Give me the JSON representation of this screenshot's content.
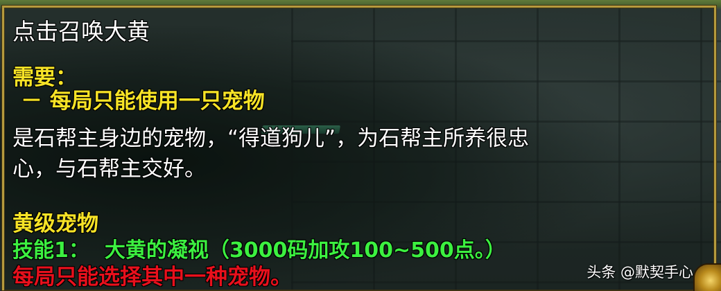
{
  "tooltip": {
    "title": "点击召唤大黄",
    "requirement_header": "需要：",
    "requirement_item": "－ 每局只能使用一只宠物",
    "description_line1": "是石帮主身边的宠物，“得道狗儿”，为石帮主所养很忠",
    "description_line2": "心，与石帮主交好。",
    "grade": "黄级宠物",
    "skill_label": "技能1：",
    "skill_text": "大黄的凝视（3000码加攻100~500点。）",
    "warning": "每局只能选择其中一种宠物。"
  },
  "watermark": {
    "text": "头条 @默契手心"
  },
  "colors": {
    "title": "#ffffff",
    "requirement": "#f7e326",
    "description": "#ffffff",
    "grade": "#f7e326",
    "skill": "#3cf040",
    "warning": "#e8101c",
    "frame": "#b59a3d"
  },
  "icons": {
    "corner_badge": "game-corner-badge-icon"
  }
}
